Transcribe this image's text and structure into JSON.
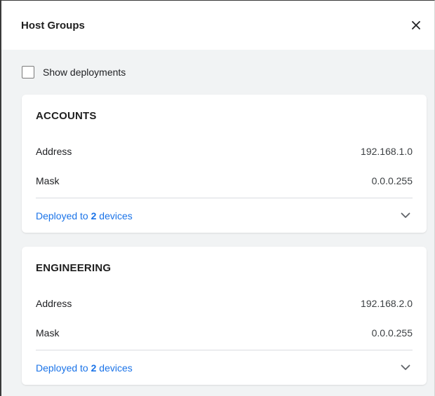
{
  "panel": {
    "title": "Host Groups"
  },
  "filter": {
    "show_deployments_label": "Show deployments",
    "show_deployments_checked": false
  },
  "groups": [
    {
      "name": "ACCOUNTS",
      "address_label": "Address",
      "address_value": "192.168.1.0",
      "mask_label": "Mask",
      "mask_value": "0.0.0.255",
      "deployed_prefix": "Deployed to",
      "deployed_count": "2",
      "deployed_suffix": "devices"
    },
    {
      "name": "ENGINEERING",
      "address_label": "Address",
      "address_value": "192.168.2.0",
      "mask_label": "Mask",
      "mask_value": "0.0.0.255",
      "deployed_prefix": "Deployed to",
      "deployed_count": "2",
      "deployed_suffix": "devices"
    }
  ],
  "icons": {
    "close": "close-icon",
    "expand": "chevron-down-icon"
  },
  "colors": {
    "link": "#1a73e8",
    "body_background": "#f1f3f4"
  }
}
